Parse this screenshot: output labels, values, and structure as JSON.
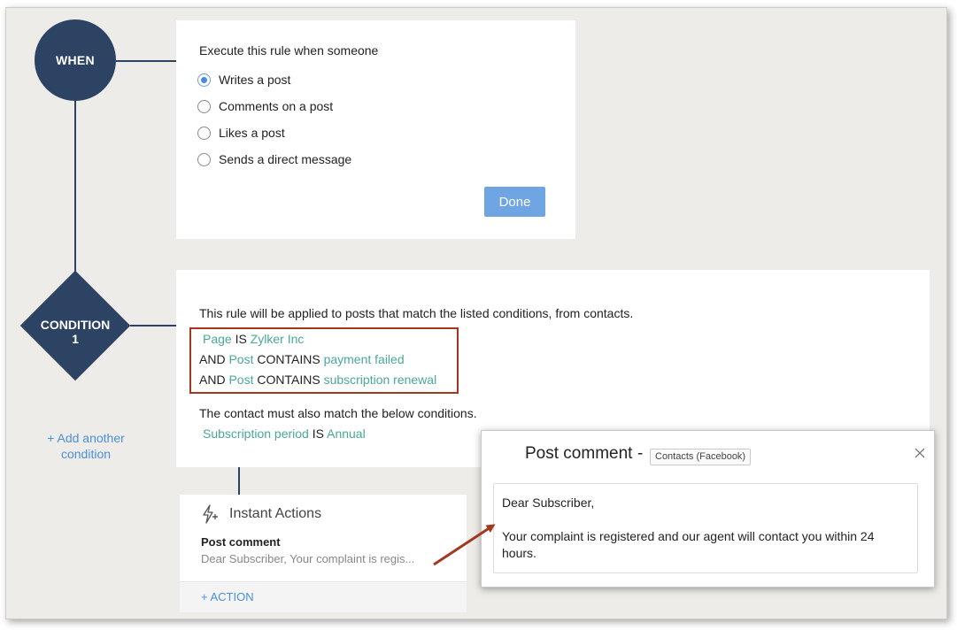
{
  "when": {
    "node_label": "WHEN",
    "title": "Execute this rule when someone",
    "options": [
      {
        "label": "Writes a post",
        "selected": true
      },
      {
        "label": "Comments on a post",
        "selected": false
      },
      {
        "label": "Likes a post",
        "selected": false
      },
      {
        "label": "Sends a direct message",
        "selected": false
      }
    ],
    "done_label": "Done"
  },
  "condition": {
    "node_label_line1": "CONDITION",
    "node_label_line2": "1",
    "description": "This rule will be applied to posts that match the listed conditions, from contacts.",
    "rules": [
      {
        "prefix": "",
        "field": "Page",
        "operator": "IS",
        "value": "Zylker Inc"
      },
      {
        "prefix": "AND",
        "field": "Post",
        "operator": "CONTAINS",
        "value": "payment failed"
      },
      {
        "prefix": "AND",
        "field": "Post",
        "operator": "CONTAINS",
        "value": "subscription renewal"
      }
    ],
    "contact_description": "The contact must also match the below conditions.",
    "contact_rule": {
      "field": "Subscription period",
      "operator": "IS",
      "value": "Annual"
    },
    "add_another_line1": "+ Add another",
    "add_another_line2": "condition"
  },
  "actions": {
    "title": "Instant Actions",
    "action_name": "Post comment",
    "action_preview": "Dear Subscriber, Your complaint is regis...",
    "add_action_label": "+ ACTION"
  },
  "popup": {
    "title": "Post comment",
    "dash": "-",
    "tag": "Contacts (Facebook)",
    "greeting": "Dear Subscriber,",
    "message": "Your complaint is registered and our agent will contact you within 24 hours."
  },
  "colors": {
    "node": "#2c4363",
    "teal_link": "#4aa89a",
    "blue_link": "#4a90d9",
    "done_button": "#6fa5e2",
    "highlight_border": "#a3381f"
  }
}
